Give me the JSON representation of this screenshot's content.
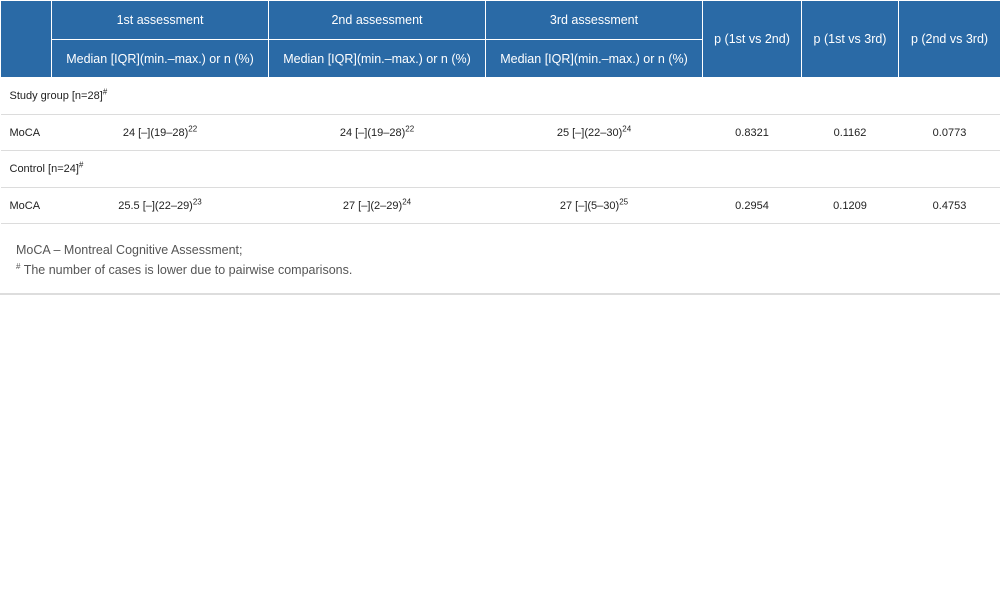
{
  "headers": {
    "assessments": [
      "1st assessment",
      "2nd assessment",
      "3rd assessment"
    ],
    "sub_label": "Median [IQR](min.–max.) or n (%)",
    "p_cols": [
      "p (1st vs 2nd)",
      "p (1st vs 3rd)",
      "p (2nd vs 3rd)"
    ]
  },
  "groups": [
    {
      "label": "Study group [n=28]",
      "label_sup": "#",
      "row": {
        "name": "MoCA",
        "cells": [
          {
            "value": "24 [–](19–28)",
            "sup": "22"
          },
          {
            "value": "24 [–](19–28)",
            "sup": "22"
          },
          {
            "value": "25 [–](22–30)",
            "sup": "24"
          }
        ],
        "p": [
          "0.8321",
          "0.1162",
          "0.0773"
        ]
      }
    },
    {
      "label": "Control [n=24]",
      "label_sup": "#",
      "row": {
        "name": "MoCA",
        "cells": [
          {
            "value": "25.5 [–](22–29)",
            "sup": "23"
          },
          {
            "value": "27 [–](2–29)",
            "sup": "24"
          },
          {
            "value": "27 [–](5–30)",
            "sup": "25"
          }
        ],
        "p": [
          "0.2954",
          "0.1209",
          "0.4753"
        ]
      }
    }
  ],
  "footnotes": {
    "line1": "MoCA – Montreal Cognitive Assessment;",
    "line2_sup": "#",
    "line2": " The number of cases is lower due to pairwise comparisons."
  }
}
